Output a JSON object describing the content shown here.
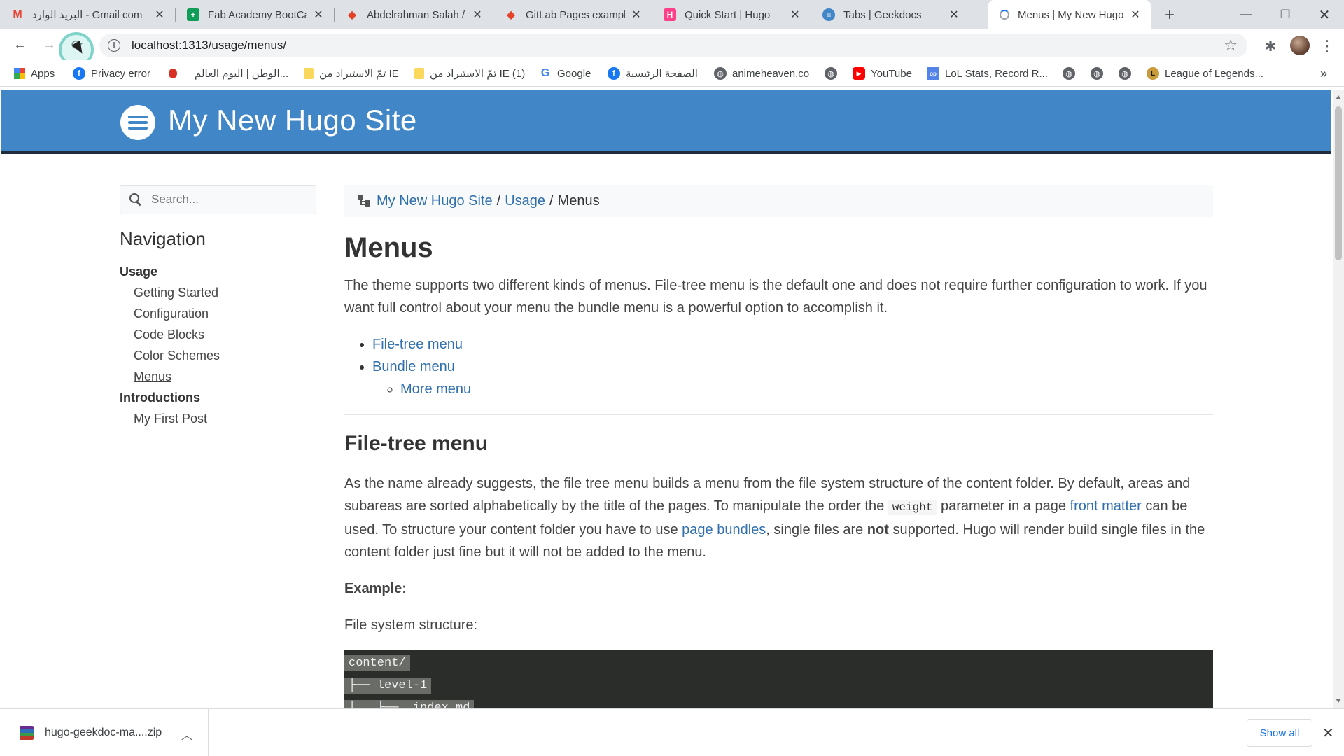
{
  "browser": {
    "tabs": [
      {
        "title": "البريد الوارد - Gmail com",
        "icon": "gmail-icon",
        "color": "#ea4335"
      },
      {
        "title": "Fab Academy BootCam",
        "icon": "sheets-icon",
        "color": "#0f9d58"
      },
      {
        "title": "Abdelrahman Salah / G",
        "icon": "gitlab-icon",
        "color": "#e24329"
      },
      {
        "title": "GitLab Pages examples",
        "icon": "gitlab-icon",
        "color": "#e24329"
      },
      {
        "title": "Quick Start | Hugo",
        "icon": "hugo-icon",
        "color": "#ff4088"
      },
      {
        "title": "Tabs | Geekdocs",
        "icon": "geekdocs-icon",
        "color": "#4186c6"
      },
      {
        "title": "Menus | My New Hugo",
        "icon": "loading-icon",
        "color": "#5f6368"
      }
    ],
    "url": "localhost:1313/usage/menus/",
    "bookmarks": [
      {
        "label": "Apps",
        "icon": "apps-grid-icon"
      },
      {
        "label": "Privacy error",
        "icon": "facebook-icon"
      },
      {
        "label": "",
        "icon": "red-dot-icon"
      },
      {
        "label": "الوطن | اليوم العالم...",
        "icon": ""
      },
      {
        "label": "تمّ الاستيراد من IE",
        "icon": "folder-icon"
      },
      {
        "label": "تمّ الاستيراد من IE (1)",
        "icon": "folder-icon"
      },
      {
        "label": "Google",
        "icon": "google-icon"
      },
      {
        "label": "الصفحة الرئيسية",
        "icon": "facebook-icon"
      },
      {
        "label": "animeheaven.co",
        "icon": "globe-icon"
      },
      {
        "label": "",
        "icon": "globe-icon"
      },
      {
        "label": "YouTube",
        "icon": "youtube-icon"
      },
      {
        "label": "LoL Stats, Record R...",
        "icon": "lol-stats-icon"
      },
      {
        "label": "",
        "icon": "globe-icon"
      },
      {
        "label": "",
        "icon": "globe-icon"
      },
      {
        "label": "",
        "icon": "globe-icon"
      },
      {
        "label": "League of Legends...",
        "icon": "league-icon"
      }
    ],
    "overflow": "»"
  },
  "site": {
    "title": "My New Hugo Site",
    "accent": "#4186c6",
    "header_border": "#1f2d3d",
    "link_color": "#2f6fad"
  },
  "sidebar": {
    "search_placeholder": "Search...",
    "heading": "Navigation",
    "sections": [
      {
        "label": "Usage",
        "items": [
          "Getting Started",
          "Configuration",
          "Code Blocks",
          "Color Schemes",
          "Menus"
        ]
      },
      {
        "label": "Introductions",
        "items": [
          "My First Post"
        ]
      }
    ],
    "active_item": "Menus"
  },
  "breadcrumb": {
    "items": [
      "My New Hugo Site",
      "Usage"
    ],
    "separator": "/",
    "current": "Menus"
  },
  "main": {
    "title": "Menus",
    "intro": "The theme supports two different kinds of menus. File-tree menu is the default one and does not require further configuration to work. If you want full control about your menu the bundle menu is a powerful option to accomplish it.",
    "toc": {
      "file_tree": "File-tree menu",
      "bundle": "Bundle menu",
      "more": "More menu"
    },
    "section_title": "File-tree menu",
    "para": {
      "p1": "As the name already suggests, the file tree menu builds a menu from the file system structure of the content folder. By default, areas and subareas are sorted alphabetically by the title of the pages. To manipulate the order the",
      "code": "weight",
      "p2": "parameter in a page",
      "link1": "front matter",
      "p3": "can be used. To structure your content folder you have to use",
      "link2": "page bundles",
      "p4": ", single files are",
      "bold": "not",
      "p5": "supported. Hugo will render build single files in the content folder just fine but it will not be added to the menu."
    },
    "example_label": "Example:",
    "fs_label": "File system structure:",
    "code_lines": [
      "content/",
      "├── level-1",
      "│   ├── _index.md"
    ]
  },
  "downloads": {
    "file": "hugo-geekdoc-ma....zip",
    "show_all": "Show all"
  }
}
